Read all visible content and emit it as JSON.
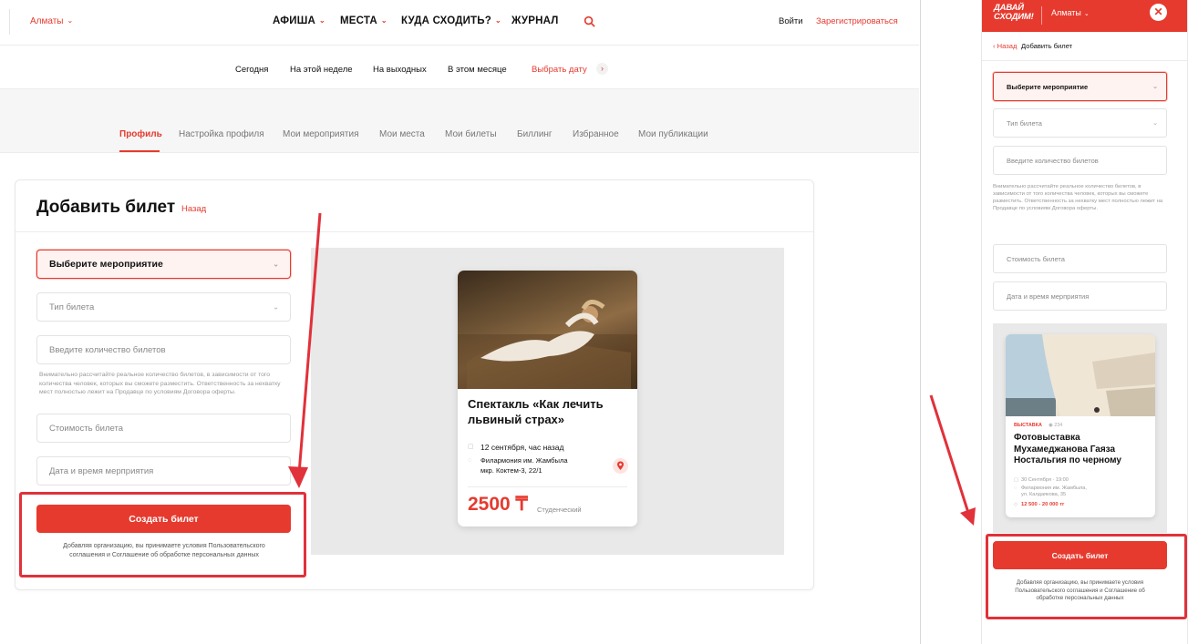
{
  "desktop": {
    "header": {
      "city": "Алматы",
      "nav": [
        "АФИША",
        "МЕСТА",
        "КУДА СХОДИТЬ?",
        "ЖУРНАЛ"
      ],
      "login": "Войти",
      "register": "Зарегистрироваться"
    },
    "date_filters": [
      "Сегодня",
      "На этой неделе",
      "На выходных",
      "В этом месяце",
      "Выбрать дату"
    ],
    "profile_tabs": [
      "Профиль",
      "Настройка профиля",
      "Мои мероприятия",
      "Мои места",
      "Мои билеты",
      "Биллинг",
      "Избранное",
      "Мои публикации"
    ],
    "form": {
      "title": "Добавить билет",
      "back": "Назад",
      "event_select": "Выберите мероприятие",
      "ticket_type": "Тип билета",
      "quantity_placeholder": "Введите количество билетов",
      "hint": "Внимательно рассчитайте реальное количество билетов, в зависимости от того количества человек, которых вы сможете разместить. Ответственность за нехватку мест полностью лежит на Продавце по условиям Договора оферты.",
      "price_placeholder": "Стоимость билета",
      "datetime_placeholder": "Дата и время мерприятия",
      "submit": "Создать билет",
      "terms": "Добавляя организацию, вы принимаете условия Пользовательского соглашения и Соглашение об обработке персональных данных"
    },
    "preview_card": {
      "title": "Спектакль «Как лечить львиный страх»",
      "date": "12 сентября, час назад",
      "place": "Филармония им. Жамбыла",
      "address": "мкр. Коктем-3, 22/1",
      "price": "2500 ₸",
      "category": "Студенческий"
    }
  },
  "mobile": {
    "logo_line1": "ДАВАЙ",
    "logo_line2": "СХОДИМ!",
    "city": "Алматы",
    "back": "Назад",
    "title": "Добавить билет",
    "event_select": "Выберите мероприятие",
    "ticket_type": "Тип билета",
    "quantity_placeholder": "Введите количество билетов",
    "hint": "Внимательно рассчитайте реальное количество билетов, в зависимости от того количества человек, которых вы сможете разместить. Ответственность за нехватку мест полностью лежит на Продавце по условиям Договора оферты.",
    "price_placeholder": "Стоимость билета",
    "datetime_placeholder": "Дата и время мерприятия",
    "card": {
      "tag": "ВЫСТАВКА",
      "views": "234",
      "title": "Фотовыставка Мухамеджанова Гаяза Ностальгия по черному",
      "date": "30 Сентября · 19:00",
      "place": "Филармония им. Жамбыла,",
      "address": "ул. Калдаякова, 35",
      "price": "12 500 - 20 000 тг"
    },
    "submit": "Создать билет",
    "terms": "Добавляя организацию, вы принимаете условия Пользовательского соглашения и Соглашение об обработке персональных данных"
  },
  "colors": {
    "accent": "#e63a2e",
    "annotation": "#e1313a",
    "preview_bg": "#e9e9e9"
  }
}
